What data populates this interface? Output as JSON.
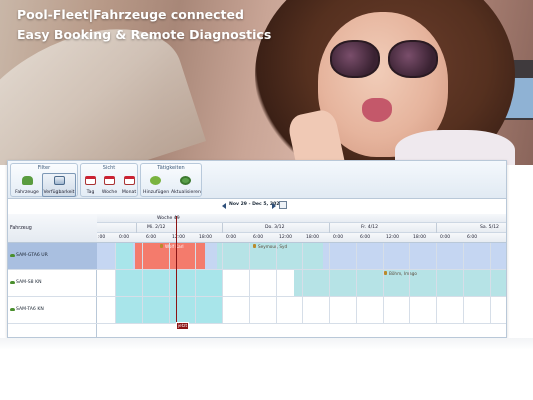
{
  "hero": {
    "title": "Pool-Fleet|Fahrzeuge connected",
    "subtitle": "Easy Booking & Remote Diagnostics"
  },
  "ribbon": {
    "groups": [
      {
        "title": "Filter",
        "buttons": [
          {
            "label": "Fahrzeuge",
            "icon": "car-icon"
          },
          {
            "label": "Verfügbarkeit",
            "icon": "availability-icon",
            "active": true
          }
        ]
      },
      {
        "title": "Sicht",
        "buttons": [
          {
            "label": "Tag",
            "icon": "calendar-day-icon"
          },
          {
            "label": "Woche",
            "icon": "calendar-week-icon"
          },
          {
            "label": "Monat",
            "icon": "calendar-month-icon"
          }
        ]
      },
      {
        "title": "Tätigkeiten",
        "buttons": [
          {
            "label": "Hinzufügen",
            "icon": "add-icon"
          },
          {
            "label": "Aktualisieren",
            "icon": "refresh-icon"
          }
        ]
      }
    ]
  },
  "datenav": {
    "range": "Nov 29 - Dec 5, 2020"
  },
  "grid": {
    "row_header_label": "Fahrzeug",
    "week_label": "Woche 49",
    "days": [
      "Mi. 2/12",
      "Do. 3/12",
      "Fr. 4/12",
      "Sa. 5/12"
    ],
    "hours": [
      ":00",
      "0:00",
      "6:00",
      "12:00",
      "18:00",
      "0:00",
      "6:00",
      "12:00",
      "18:00",
      "0:00",
      "6:00",
      "12:00",
      "18:00",
      "0:00",
      "6:00"
    ],
    "vehicles": [
      {
        "label": "SAM-GTA6 UR",
        "selected": true
      },
      {
        "label": "SAM-S8 KN",
        "selected": false
      },
      {
        "label": "SAM-TA6 KN",
        "selected": false
      }
    ],
    "bookings": [
      {
        "label": "Wolf Karl",
        "row": 0,
        "color": "#f47b6c"
      },
      {
        "label": "Seymour, Syd",
        "row": 0,
        "color": "#b6e3e6"
      },
      {
        "label": "Böhm, Imago",
        "row": 1,
        "color": "#b6e3e6"
      }
    ],
    "now_badge": "jetzt"
  },
  "colors": {
    "available": "#c5d6f2",
    "available_alt": "#d2e0f5",
    "selected_row": "#a9bfe0",
    "booking_teal": "#a8e5ea",
    "booking_red": "#f47b6c",
    "now_marker": "#8b1414"
  }
}
